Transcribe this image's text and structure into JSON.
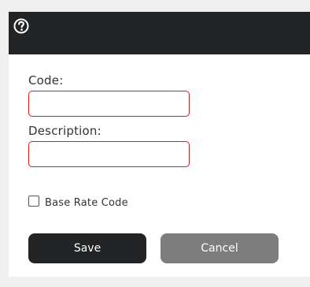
{
  "dialog": {
    "header": {
      "help_icon": "question-circle-icon"
    },
    "fields": {
      "code": {
        "label": "Code:",
        "value": "",
        "placeholder": ""
      },
      "description": {
        "label": "Description:",
        "value": "",
        "placeholder": ""
      }
    },
    "base_rate_code": {
      "label": "Base Rate Code",
      "checked": false
    },
    "buttons": {
      "save_label": "Save",
      "cancel_label": "Cancel"
    }
  },
  "colors": {
    "header_bg": "#222426",
    "required_border": "#cc1f1f",
    "save_bg": "#222426",
    "cancel_bg": "#7d7d7d",
    "page_bg": "#f0f0f0"
  }
}
